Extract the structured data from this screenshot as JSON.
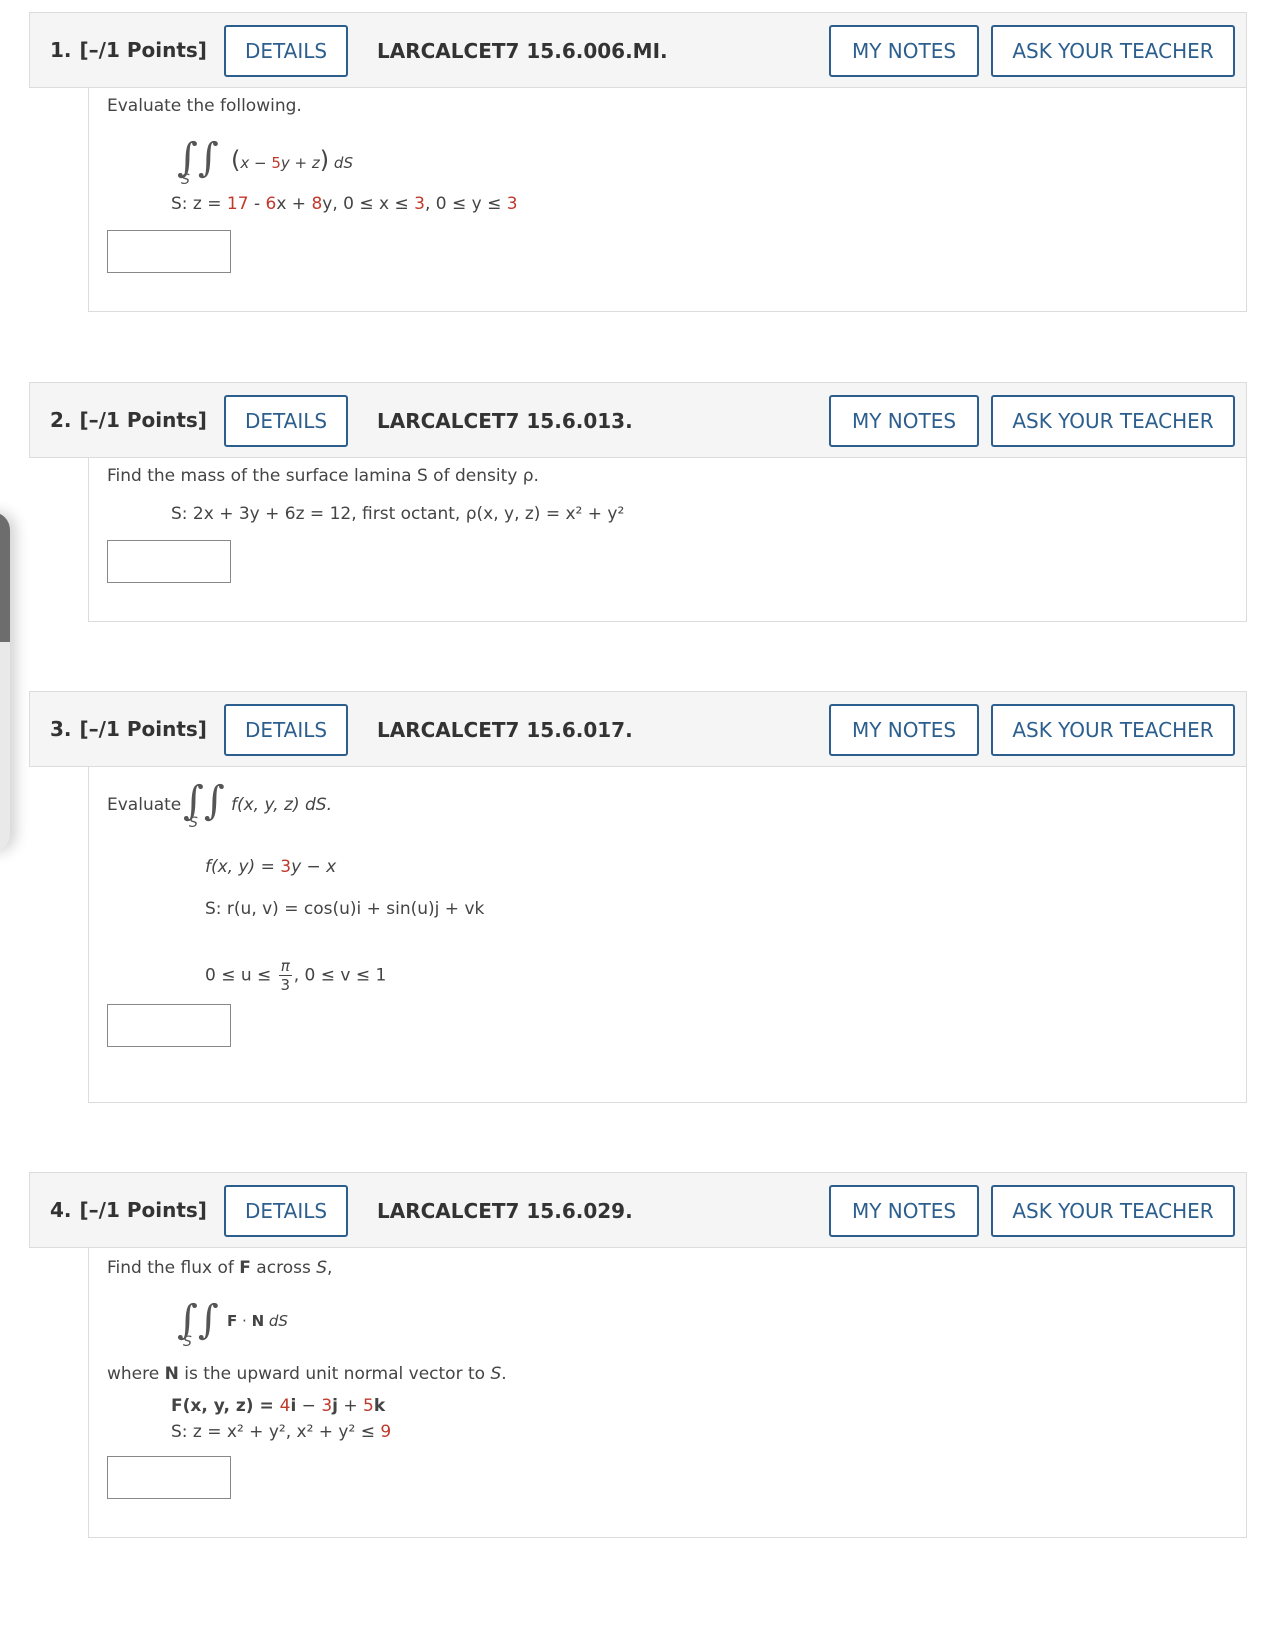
{
  "questions": [
    {
      "number": "1.",
      "points": "[–/1 Points]",
      "details": "DETAILS",
      "code": "LARCALCET7 15.6.006.MI.",
      "my_notes": "MY NOTES",
      "ask_teacher": "ASK YOUR TEACHER",
      "prompt": "Evaluate the following.",
      "integrand_pre": "x − ",
      "integrand_red": "5",
      "integrand_post": "y + z",
      "ds": "dS",
      "surface_a": "S: z = ",
      "surface_c1": "17",
      "surface_b": " - ",
      "surface_c2": "6",
      "surface_d": "x + ",
      "surface_c3": "8",
      "surface_e": "y, 0 ≤ x ≤ ",
      "surface_c4": "3",
      "surface_f": ", 0 ≤ y ≤ ",
      "surface_c5": "3"
    },
    {
      "number": "2.",
      "points": "[–/1 Points]",
      "details": "DETAILS",
      "code": "LARCALCET7 15.6.013.",
      "my_notes": "MY NOTES",
      "ask_teacher": "ASK YOUR TEACHER",
      "prompt": "Find the mass of the surface lamina S of density ρ.",
      "surface": "S: 2x + 3y + 6z = 12, first octant, ρ(x, y, z) = x² + y²"
    },
    {
      "number": "3.",
      "points": "[–/1 Points]",
      "details": "DETAILS",
      "code": "LARCALCET7 15.6.017.",
      "my_notes": "MY NOTES",
      "ask_teacher": "ASK YOUR TEACHER",
      "evaluate": "Evaluate",
      "integral_expr": "f(x, y, z) dS.",
      "f_a": "f(x, y) = ",
      "f_red": "3",
      "f_b": "y − x",
      "r_def": "S: r(u, v) = cos(u)i + sin(u)j + vk",
      "bounds_a": "0 ≤ u ≤",
      "pi": "π",
      "three": "3",
      "bounds_b": ", 0 ≤ v ≤ 1"
    },
    {
      "number": "4.",
      "points": "[–/1 Points]",
      "details": "DETAILS",
      "code": "LARCALCET7 15.6.029.",
      "my_notes": "MY NOTES",
      "ask_teacher": "ASK YOUR TEACHER",
      "prompt_a": "Find the flux of ",
      "prompt_F": "F",
      "prompt_b": " across ",
      "prompt_S": "S",
      "prompt_c": ",",
      "integral_expr_F": "F",
      "integral_expr_dot": " · ",
      "integral_expr_N": "N",
      "integral_expr_ds": " dS",
      "where_a": "where ",
      "where_N": "N",
      "where_b": " is the upward unit normal vector to ",
      "where_S": "S",
      "where_c": ".",
      "F_a": "F(x, y, z) = ",
      "F_c1": "4",
      "F_i": "i",
      "F_b": " − ",
      "F_c2": "3",
      "F_j": "j",
      "F_plus": " + ",
      "F_c3": "5",
      "F_k": "k",
      "S_a": "S: z = x² + y², x² + y² ≤ ",
      "S_c": "9"
    }
  ]
}
